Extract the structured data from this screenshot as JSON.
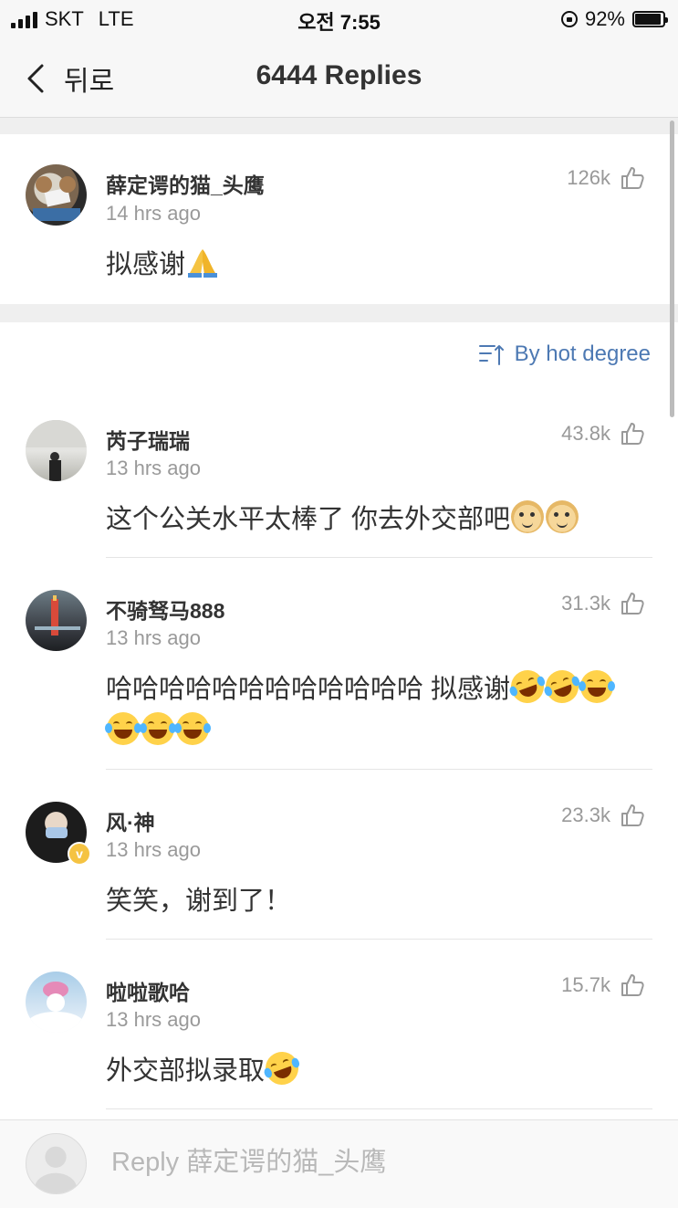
{
  "status": {
    "carrier": "SKT",
    "network": "LTE",
    "time": "오전 7:55",
    "battery": "92%",
    "battery_level": 0.92
  },
  "nav": {
    "back_label": "뒤로",
    "title": "6444 Replies"
  },
  "post": {
    "name": "薛定谔的猫_头鹰",
    "time": "14 hrs ago",
    "likes": "126k",
    "text": "拟感谢",
    "emojis": [
      "pray"
    ]
  },
  "sort_label": "By hot degree",
  "comments": [
    {
      "name": "芮子瑞瑞",
      "time": "13 hrs ago",
      "likes": "43.8k",
      "text": "这个公关水平太棒了 你去外交部吧",
      "emojis": [
        "doge",
        "doge"
      ]
    },
    {
      "name": "不骑驽马888",
      "time": "13 hrs ago",
      "likes": "31.3k",
      "text": "哈哈哈哈哈哈哈哈哈哈哈哈  拟感谢",
      "emojis": [
        "laugh-tilt",
        "laugh-tilt",
        "laugh",
        "laugh",
        "laugh",
        "laugh"
      ]
    },
    {
      "name": "风·神",
      "time": "13 hrs ago",
      "likes": "23.3k",
      "text": "笑笑，谢到了！",
      "emojis": [],
      "verified": true
    },
    {
      "name": "啦啦歌哈",
      "time": "13 hrs ago",
      "likes": "15.7k",
      "text": "外交部拟录取",
      "emojis": [
        "laugh-tilt"
      ]
    }
  ],
  "reply": {
    "placeholder": "Reply 薛定谔的猫_头鹰"
  },
  "colors": {
    "link_blue": "#4d79b3",
    "muted_gray": "#999999",
    "band_gray": "#efefef"
  }
}
